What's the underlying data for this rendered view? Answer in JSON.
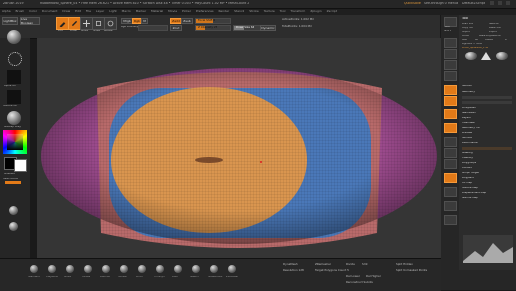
{
  "window": {
    "title": "ZBrush 2019",
    "doc_info": "Rubberbowl_Sphere_04 • Free Mem 26.621 • Active Mem 810 • Scratch Disk 48 • Timer 0.003 • PolyCount 1.02 MP • MeshCount 2"
  },
  "header_right": {
    "quicksave": "QuickSave",
    "see_through": "See-through 0",
    "menus": "Menus",
    "script": "DefaultZScript"
  },
  "menu": {
    "items": [
      "Alpha",
      "Brush",
      "Color",
      "Document",
      "Draw",
      "Edit",
      "File",
      "Layer",
      "Light",
      "Macro",
      "Marker",
      "Material",
      "Movie",
      "Picker",
      "Preferences",
      "Render",
      "Stencil",
      "Stroke",
      "Texture",
      "Tool",
      "Transform",
      "Zplugin",
      "Zscript"
    ]
  },
  "top_shelf": {
    "lightbox": "LightBox",
    "live_boolean": "Live Boolean",
    "edit": "Edit",
    "draw": "Draw",
    "move": "Move",
    "scale": "Scale",
    "rotate": "Rotate",
    "mrgb": "Mrgb",
    "rgb": "Rgb",
    "m": "M",
    "zadd": "Zadd",
    "zsub": "Zsub",
    "zcut": "Zcut",
    "rgb_intensity": "Rgb Intensity",
    "z_intensity": "Z Intensity 25",
    "focal_shift": "Focal Shift 0",
    "draw_size": "Draw Size 64",
    "dynamic": "Dynamic",
    "active_points": "ActivePoints: 1.002 Mil",
    "total_points": "TotalPoints: 1.004 Mil",
    "levels": {
      "rgb": 0.0,
      "z_intensity": 0.25,
      "focal_shift": 0.5,
      "draw_size": 0.4
    }
  },
  "left_shelf": {
    "alpha_off": "Alpha Off",
    "texture_off": "Texture Off",
    "matcap": "MatCap Gray",
    "gradient": "Gradient",
    "switch_color": "SwitchColor",
    "alternate": "Alternate"
  },
  "viewport": {
    "model": "sphere-mesh",
    "colors": {
      "magenta": "#9b4a8c",
      "blue": "#4a78b8",
      "orange": "#d9954f",
      "rim": "#b86a6a"
    }
  },
  "right_shelf": {
    "bpr": "BPR",
    "spix": "SPix 3",
    "scroll": "Scroll",
    "zoom": "Zoom",
    "actual": "Actual",
    "aahalf": "AAHalf",
    "persp": "Persp",
    "floor": "Floor",
    "local": "Local",
    "frame": "Frame",
    "move": "Move",
    "zoom3d": "ZoomD",
    "rotate": "Rotate",
    "polyf": "PolyF",
    "transp": "Transp",
    "solo": "Solo",
    "xpose": "Xpose"
  },
  "tool_panel": {
    "title": "Tool",
    "load_tool": "Load Tool",
    "save_as": "Save As",
    "copy_tool": "Copy Tool",
    "paste_tool": "Paste Tool",
    "import": "Import",
    "export": "Export",
    "clone": "Clone",
    "make_polymesh": "Make PolyMesh3D",
    "goz": "GoZ",
    "all": "All",
    "visible": "Visible",
    "r": "R",
    "lightbox_tools": "Lightbox > Tools",
    "tool_name": "PM3D_Sphere3D_1 48",
    "subtool": "Subtool",
    "geometry": "Geometry",
    "array_mesh": "ArrayMesh",
    "nano_mesh": "NanoMesh",
    "layers": "Layers",
    "fibermesh": "FiberMesh",
    "geometry_hd": "Geometry HD",
    "preview": "Preview",
    "surface": "Surface",
    "deformation": "Deformation",
    "masking": "Masking",
    "visibility": "Visibility",
    "polygroups": "Polygroups",
    "contact": "Contact",
    "morph_target": "Morph Target",
    "polypaint": "Polypaint",
    "uv_map": "UV Map",
    "texture_map": "Texture Map",
    "displacement_map": "Displacement Map",
    "normal_map": "Normal Map"
  },
  "bottom_shelf": {
    "brushes": [
      "Standard",
      "ClayBuild",
      "Move",
      "Inflate",
      "DamStd",
      "hPolish",
      "Pinch",
      "TrimDyn",
      "Dam",
      "Slash3",
      "SnakeHook",
      "ZModeler"
    ],
    "dynamesh": "DynaMesh",
    "resolution": "Resolution 128",
    "zremesher": "ZRemesher",
    "target_polygons": "Target Polygons Count 5",
    "divide": "Divide",
    "smt": "Smt",
    "split_hidden": "Split Hidden",
    "split_unmasked": "Split Unmasked Points",
    "del_lower": "Del Lower",
    "del_higher": "Del Higher",
    "reconstruct": "Reconstruct Subdiv"
  }
}
